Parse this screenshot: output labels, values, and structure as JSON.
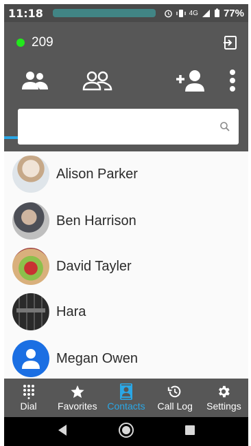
{
  "status_bar": {
    "time": "11:18",
    "network": "4G",
    "battery": "77%"
  },
  "header": {
    "extension": "209",
    "presence_color": "#22e81c",
    "accent_color": "#2aa7e6"
  },
  "tabs": [
    {
      "icon": "contacts-icon",
      "active": true
    },
    {
      "icon": "groups-icon",
      "active": false
    },
    {
      "icon": "add-contact-icon"
    },
    {
      "icon": "more-vert-icon"
    }
  ],
  "search": {
    "placeholder": "",
    "value": ""
  },
  "contacts": [
    {
      "name": "Alison Parker",
      "avatar": "photo"
    },
    {
      "name": "Ben Harrison",
      "avatar": "photo"
    },
    {
      "name": "David Tayler",
      "avatar": "photo"
    },
    {
      "name": "Hara",
      "avatar": "photo"
    },
    {
      "name": "Megan Owen",
      "avatar": "default-person-icon"
    }
  ],
  "bottom_nav": [
    {
      "label": "Dial",
      "icon": "dialpad-icon"
    },
    {
      "label": "Favorites",
      "icon": "star-icon"
    },
    {
      "label": "Contacts",
      "icon": "contacts-book-icon",
      "active": true
    },
    {
      "label": "Call Log",
      "icon": "history-icon"
    },
    {
      "label": "Settings",
      "icon": "gear-icon"
    }
  ]
}
